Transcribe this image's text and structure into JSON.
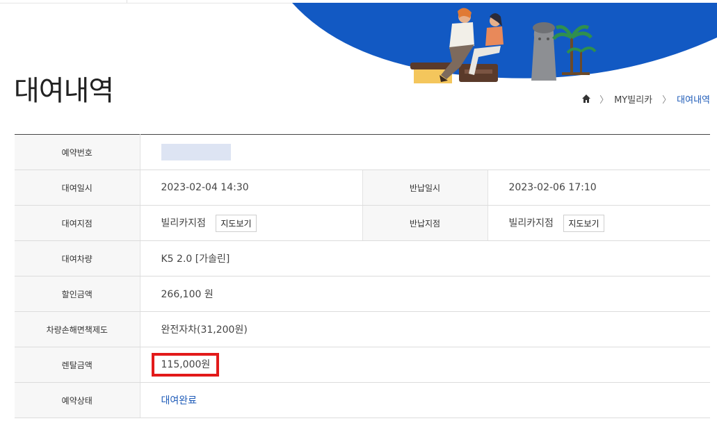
{
  "page": {
    "title": "대여내역"
  },
  "breadcrumb": {
    "items": [
      "MY빌리카",
      "대여내역"
    ],
    "separator": "〉"
  },
  "buttons": {
    "map_label": "지도보기"
  },
  "rows": {
    "reservation_no": {
      "label": "예약번호",
      "value": ""
    },
    "rent_datetime": {
      "label": "대여일시",
      "value": "2023-02-04 14:30"
    },
    "return_datetime": {
      "label": "반납일시",
      "value": "2023-02-06 17:10"
    },
    "rent_branch": {
      "label": "대여지점",
      "value": "빌리카지점"
    },
    "return_branch": {
      "label": "반납지점",
      "value": "빌리카지점"
    },
    "vehicle": {
      "label": "대여차량",
      "value": "K5 2.0 [가솔린]"
    },
    "discount": {
      "label": "할인금액",
      "value": "266,100 원"
    },
    "insurance": {
      "label": "차량손해면책제도",
      "value": "완전자차(31,200원)"
    },
    "rental_fee": {
      "label": "렌탈금액",
      "value": "115,000원"
    },
    "status": {
      "label": "예약상태",
      "value": "대여완료"
    }
  },
  "colors": {
    "accent": "#1e5bb8",
    "banner": "#1259c3",
    "highlight": "#e21a1a"
  },
  "icons": {
    "home": "home-icon"
  }
}
